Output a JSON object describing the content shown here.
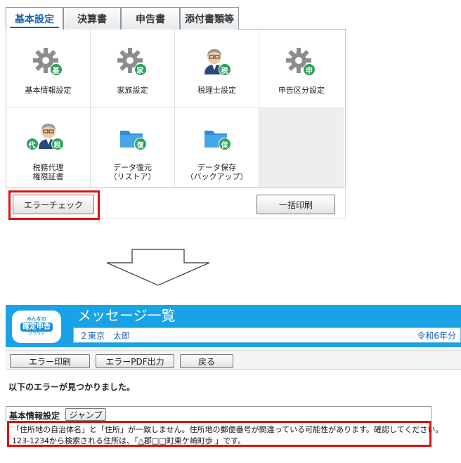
{
  "tabs": [
    {
      "label": "基本設定",
      "active": true
    },
    {
      "label": "決算書",
      "active": false
    },
    {
      "label": "申告書",
      "active": false
    },
    {
      "label": "添付書類等",
      "active": false
    }
  ],
  "tiles": [
    {
      "label": "基本情報設定",
      "icon": "gear-icon",
      "badges": [
        "基"
      ]
    },
    {
      "label": "家族設定",
      "icon": "gear-icon",
      "badges": [
        "家"
      ]
    },
    {
      "label": "税理士設定",
      "icon": "person-icon",
      "badges": [
        "税"
      ]
    },
    {
      "label": "申告区分設定",
      "icon": "gear-icon",
      "badges": [
        "申"
      ]
    },
    {
      "label": "税務代理\n権限証書",
      "icon": "person-icon",
      "badges": [
        "代",
        "税"
      ]
    },
    {
      "label": "データ復元\n（リストア）",
      "icon": "folder-icon",
      "badges": [
        "復"
      ]
    },
    {
      "label": "データ保存\n（バックアップ）",
      "icon": "folder-icon",
      "badges": [
        "保"
      ]
    }
  ],
  "buttons": {
    "error_check": "エラーチェック",
    "bulk_print": "一括印刷"
  },
  "message_screen": {
    "logo": {
      "line1": "みんなの",
      "line2": "確定申告",
      "line3": "クラウド"
    },
    "title": "メッセージ一覧",
    "user": "２東京　太郎",
    "year": "令和6年分",
    "toolbar": {
      "error_print": "エラー印刷",
      "error_pdf": "エラーPDF出力",
      "back": "戻る"
    },
    "heading": "以下のエラーが見つかりました。",
    "section": {
      "name": "基本情報設定",
      "jump": "ジャンプ"
    },
    "errors": [
      "「住所地の自治体名」と「住所」が一致しません。住所地の郵便番号が間違っている可能性があります。確認してください。",
      "123-1234から検索される住所は、「△郡□□町東ケ崎町歩 」です。"
    ]
  },
  "colors": {
    "accent_blue": "#19a3e6",
    "badge_green": "#2aa15a",
    "highlight_red": "#e01010",
    "tab_text_blue": "#1a5fb4"
  }
}
